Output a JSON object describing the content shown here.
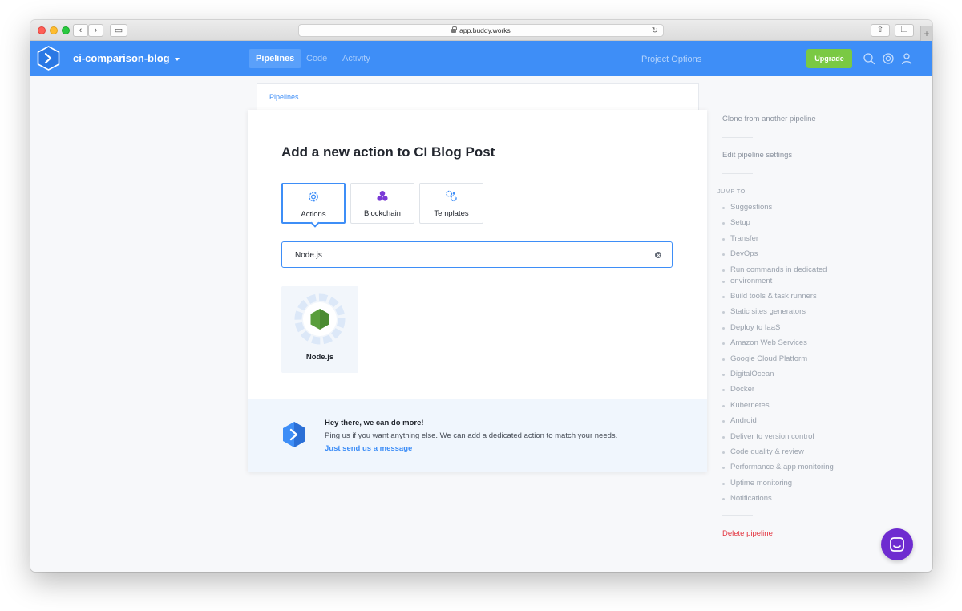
{
  "browser": {
    "url": "app.buddy.works"
  },
  "header": {
    "project_name": "ci-comparison-blog",
    "tabs": [
      {
        "label": "Pipelines",
        "active": true
      },
      {
        "label": "Code",
        "active": false
      },
      {
        "label": "Activity",
        "active": false
      }
    ],
    "project_options": "Project Options",
    "upgrade_label": "Upgrade",
    "accent_color": "#3e8ef7",
    "upgrade_color": "#7ac943"
  },
  "breadcrumb": "Pipelines",
  "main": {
    "title": "Add a new action to CI Blog Post",
    "type_tabs": [
      {
        "label": "Actions",
        "icon": "gear-icon",
        "active": true
      },
      {
        "label": "Blockchain",
        "icon": "blockchain-icon",
        "active": false
      },
      {
        "label": "Templates",
        "icon": "templates-icon",
        "active": false
      }
    ],
    "search_value": "Node.js",
    "results": [
      {
        "label": "Node.js",
        "icon": "nodejs-icon"
      }
    ],
    "help": {
      "title": "Hey there, we can do more!",
      "text": "Ping us if you want anything else. We can add a dedicated action to match your needs.",
      "link": "Just send us a message"
    }
  },
  "sidebar": {
    "clone": "Clone from another pipeline",
    "edit": "Edit pipeline settings",
    "jump_to_label": "JUMP TO",
    "jump_items": [
      "Suggestions",
      "Setup",
      "Transfer",
      "DevOps",
      "Run commands in dedicated",
      "environment",
      "Build tools & task runners",
      "Static sites generators",
      "Deploy to IaaS",
      "Amazon Web Services",
      "Google Cloud Platform",
      "DigitalOcean",
      "Docker",
      "Kubernetes",
      "Android",
      "Deliver to version control",
      "Code quality & review",
      "Performance & app monitoring",
      "Uptime monitoring",
      "Notifications"
    ],
    "delete": "Delete pipeline"
  }
}
